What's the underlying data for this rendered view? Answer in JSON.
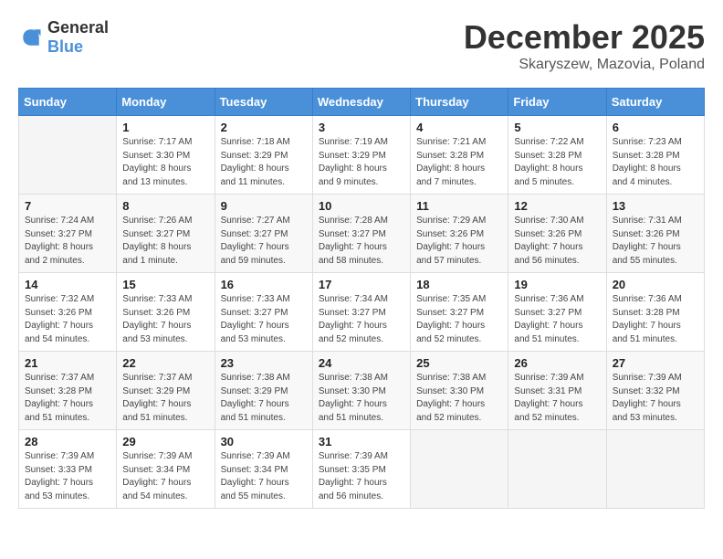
{
  "header": {
    "logo": {
      "general": "General",
      "blue": "Blue"
    },
    "title": "December 2025",
    "subtitle": "Skaryszew, Mazovia, Poland"
  },
  "days_of_week": [
    "Sunday",
    "Monday",
    "Tuesday",
    "Wednesday",
    "Thursday",
    "Friday",
    "Saturday"
  ],
  "weeks": [
    [
      {
        "day": "",
        "info": ""
      },
      {
        "day": "1",
        "info": "Sunrise: 7:17 AM\nSunset: 3:30 PM\nDaylight: 8 hours\nand 13 minutes."
      },
      {
        "day": "2",
        "info": "Sunrise: 7:18 AM\nSunset: 3:29 PM\nDaylight: 8 hours\nand 11 minutes."
      },
      {
        "day": "3",
        "info": "Sunrise: 7:19 AM\nSunset: 3:29 PM\nDaylight: 8 hours\nand 9 minutes."
      },
      {
        "day": "4",
        "info": "Sunrise: 7:21 AM\nSunset: 3:28 PM\nDaylight: 8 hours\nand 7 minutes."
      },
      {
        "day": "5",
        "info": "Sunrise: 7:22 AM\nSunset: 3:28 PM\nDaylight: 8 hours\nand 5 minutes."
      },
      {
        "day": "6",
        "info": "Sunrise: 7:23 AM\nSunset: 3:28 PM\nDaylight: 8 hours\nand 4 minutes."
      }
    ],
    [
      {
        "day": "7",
        "info": "Sunrise: 7:24 AM\nSunset: 3:27 PM\nDaylight: 8 hours\nand 2 minutes."
      },
      {
        "day": "8",
        "info": "Sunrise: 7:26 AM\nSunset: 3:27 PM\nDaylight: 8 hours\nand 1 minute."
      },
      {
        "day": "9",
        "info": "Sunrise: 7:27 AM\nSunset: 3:27 PM\nDaylight: 7 hours\nand 59 minutes."
      },
      {
        "day": "10",
        "info": "Sunrise: 7:28 AM\nSunset: 3:27 PM\nDaylight: 7 hours\nand 58 minutes."
      },
      {
        "day": "11",
        "info": "Sunrise: 7:29 AM\nSunset: 3:26 PM\nDaylight: 7 hours\nand 57 minutes."
      },
      {
        "day": "12",
        "info": "Sunrise: 7:30 AM\nSunset: 3:26 PM\nDaylight: 7 hours\nand 56 minutes."
      },
      {
        "day": "13",
        "info": "Sunrise: 7:31 AM\nSunset: 3:26 PM\nDaylight: 7 hours\nand 55 minutes."
      }
    ],
    [
      {
        "day": "14",
        "info": "Sunrise: 7:32 AM\nSunset: 3:26 PM\nDaylight: 7 hours\nand 54 minutes."
      },
      {
        "day": "15",
        "info": "Sunrise: 7:33 AM\nSunset: 3:26 PM\nDaylight: 7 hours\nand 53 minutes."
      },
      {
        "day": "16",
        "info": "Sunrise: 7:33 AM\nSunset: 3:27 PM\nDaylight: 7 hours\nand 53 minutes."
      },
      {
        "day": "17",
        "info": "Sunrise: 7:34 AM\nSunset: 3:27 PM\nDaylight: 7 hours\nand 52 minutes."
      },
      {
        "day": "18",
        "info": "Sunrise: 7:35 AM\nSunset: 3:27 PM\nDaylight: 7 hours\nand 52 minutes."
      },
      {
        "day": "19",
        "info": "Sunrise: 7:36 AM\nSunset: 3:27 PM\nDaylight: 7 hours\nand 51 minutes."
      },
      {
        "day": "20",
        "info": "Sunrise: 7:36 AM\nSunset: 3:28 PM\nDaylight: 7 hours\nand 51 minutes."
      }
    ],
    [
      {
        "day": "21",
        "info": "Sunrise: 7:37 AM\nSunset: 3:28 PM\nDaylight: 7 hours\nand 51 minutes."
      },
      {
        "day": "22",
        "info": "Sunrise: 7:37 AM\nSunset: 3:29 PM\nDaylight: 7 hours\nand 51 minutes."
      },
      {
        "day": "23",
        "info": "Sunrise: 7:38 AM\nSunset: 3:29 PM\nDaylight: 7 hours\nand 51 minutes."
      },
      {
        "day": "24",
        "info": "Sunrise: 7:38 AM\nSunset: 3:30 PM\nDaylight: 7 hours\nand 51 minutes."
      },
      {
        "day": "25",
        "info": "Sunrise: 7:38 AM\nSunset: 3:30 PM\nDaylight: 7 hours\nand 52 minutes."
      },
      {
        "day": "26",
        "info": "Sunrise: 7:39 AM\nSunset: 3:31 PM\nDaylight: 7 hours\nand 52 minutes."
      },
      {
        "day": "27",
        "info": "Sunrise: 7:39 AM\nSunset: 3:32 PM\nDaylight: 7 hours\nand 53 minutes."
      }
    ],
    [
      {
        "day": "28",
        "info": "Sunrise: 7:39 AM\nSunset: 3:33 PM\nDaylight: 7 hours\nand 53 minutes."
      },
      {
        "day": "29",
        "info": "Sunrise: 7:39 AM\nSunset: 3:34 PM\nDaylight: 7 hours\nand 54 minutes."
      },
      {
        "day": "30",
        "info": "Sunrise: 7:39 AM\nSunset: 3:34 PM\nDaylight: 7 hours\nand 55 minutes."
      },
      {
        "day": "31",
        "info": "Sunrise: 7:39 AM\nSunset: 3:35 PM\nDaylight: 7 hours\nand 56 minutes."
      },
      {
        "day": "",
        "info": ""
      },
      {
        "day": "",
        "info": ""
      },
      {
        "day": "",
        "info": ""
      }
    ]
  ]
}
